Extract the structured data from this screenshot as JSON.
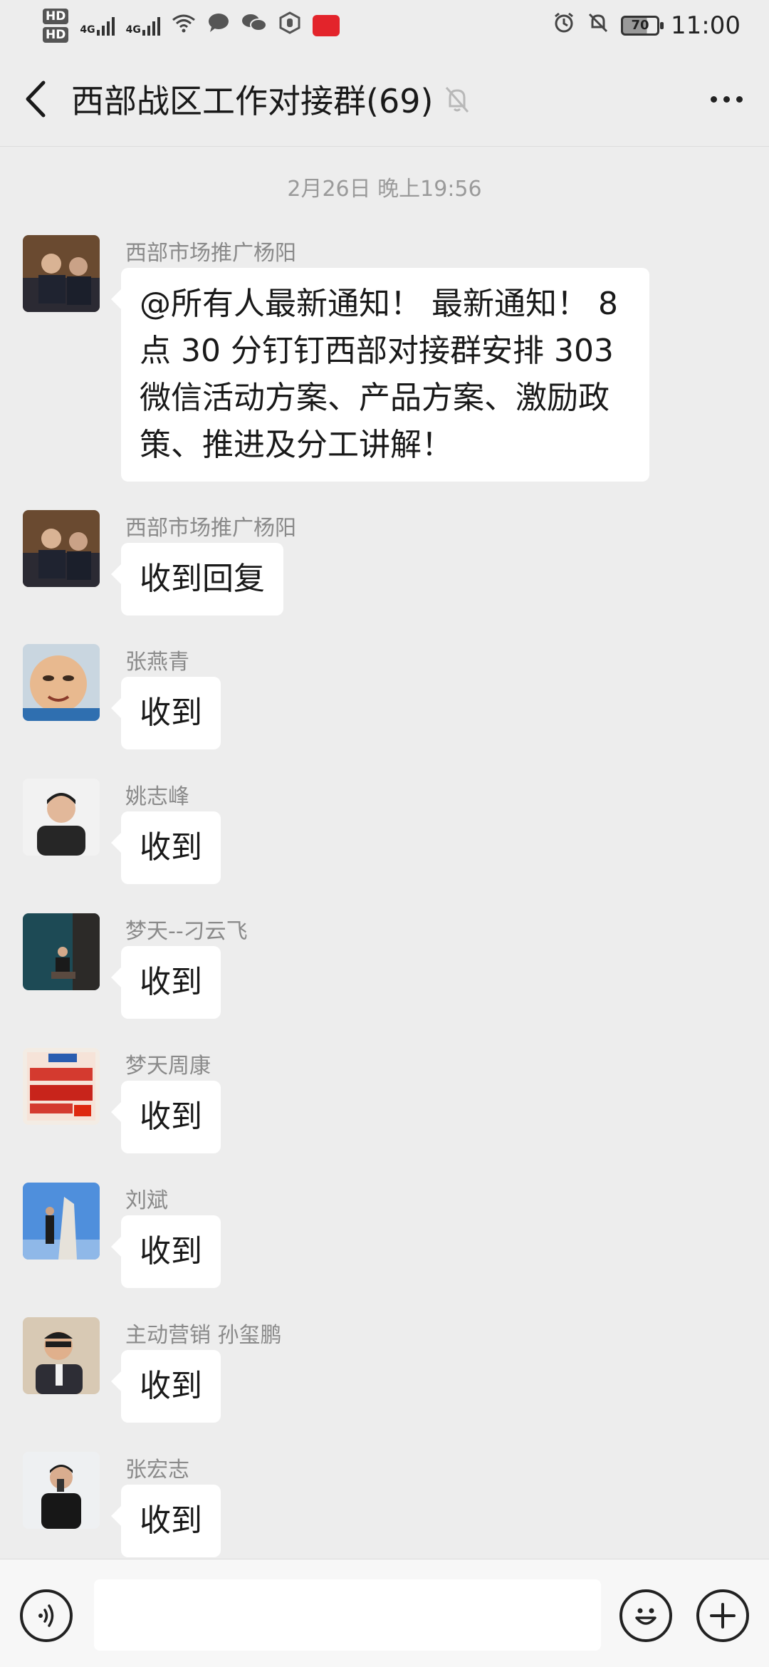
{
  "status_bar": {
    "hd1": "HD",
    "hd2": "HD",
    "net1": "4G",
    "net2": "4G",
    "battery": "70",
    "time": "11:00"
  },
  "header": {
    "title": "西部战区工作对接群(69)"
  },
  "timestamp": "2月26日 晚上19:56",
  "messages": [
    {
      "sender": "西部市场推广杨阳",
      "text": "@所有人最新通知！ 最新通知！ 8点 30 分钉钉西部对接群安排 303 微信活动方案、产品方案、激励政策、推进及分工讲解！"
    },
    {
      "sender": "西部市场推广杨阳",
      "text": "收到回复"
    },
    {
      "sender": "张燕青",
      "text": "收到"
    },
    {
      "sender": "姚志峰",
      "text": "收到"
    },
    {
      "sender": "梦天--刁云飞",
      "text": "收到"
    },
    {
      "sender": "梦天周康",
      "text": "收到"
    },
    {
      "sender": "刘斌",
      "text": "收到"
    },
    {
      "sender": "主动营销 孙玺鹏",
      "text": "收到"
    },
    {
      "sender": "张宏志",
      "text": "收到"
    }
  ],
  "input": {
    "placeholder": ""
  }
}
